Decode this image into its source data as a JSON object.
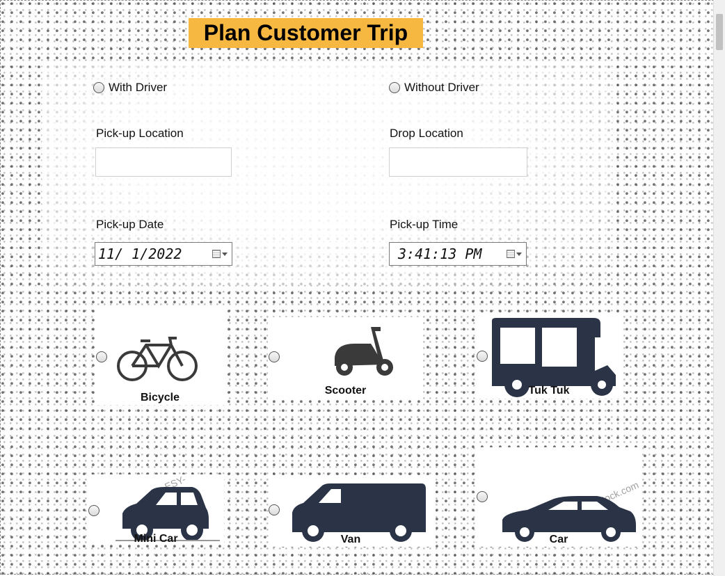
{
  "page": {
    "title": "Plan Customer Trip"
  },
  "driver_options": {
    "with_driver": "With Driver",
    "without_driver": "Without Driver"
  },
  "form": {
    "pickup_location_label": "Pick-up Location",
    "pickup_location_value": "",
    "drop_location_label": "Drop Location",
    "drop_location_value": "",
    "pickup_date_label": "Pick-up Date",
    "pickup_date_value": "11/ 1/2022",
    "pickup_time_label": "Pick-up Time",
    "pickup_time_value": "3:41:13 PM"
  },
  "vehicles": [
    {
      "label": "Bicycle",
      "icon": "bicycle-icon"
    },
    {
      "label": "Scooter",
      "icon": "scooter-icon"
    },
    {
      "label": "Tuk Tuk",
      "icon": "tuk-tuk-icon"
    },
    {
      "label": "Mini Car",
      "icon": "mini-car-icon"
    },
    {
      "label": "Van",
      "icon": "van-icon"
    },
    {
      "label": "Car",
      "icon": "car-icon"
    }
  ],
  "watermarks": {
    "stock_site": "www.agefotostock.com",
    "car_stock": "ESY-"
  },
  "colors": {
    "title_background": "#f7b842",
    "vehicle_icon": "#2b3447"
  }
}
